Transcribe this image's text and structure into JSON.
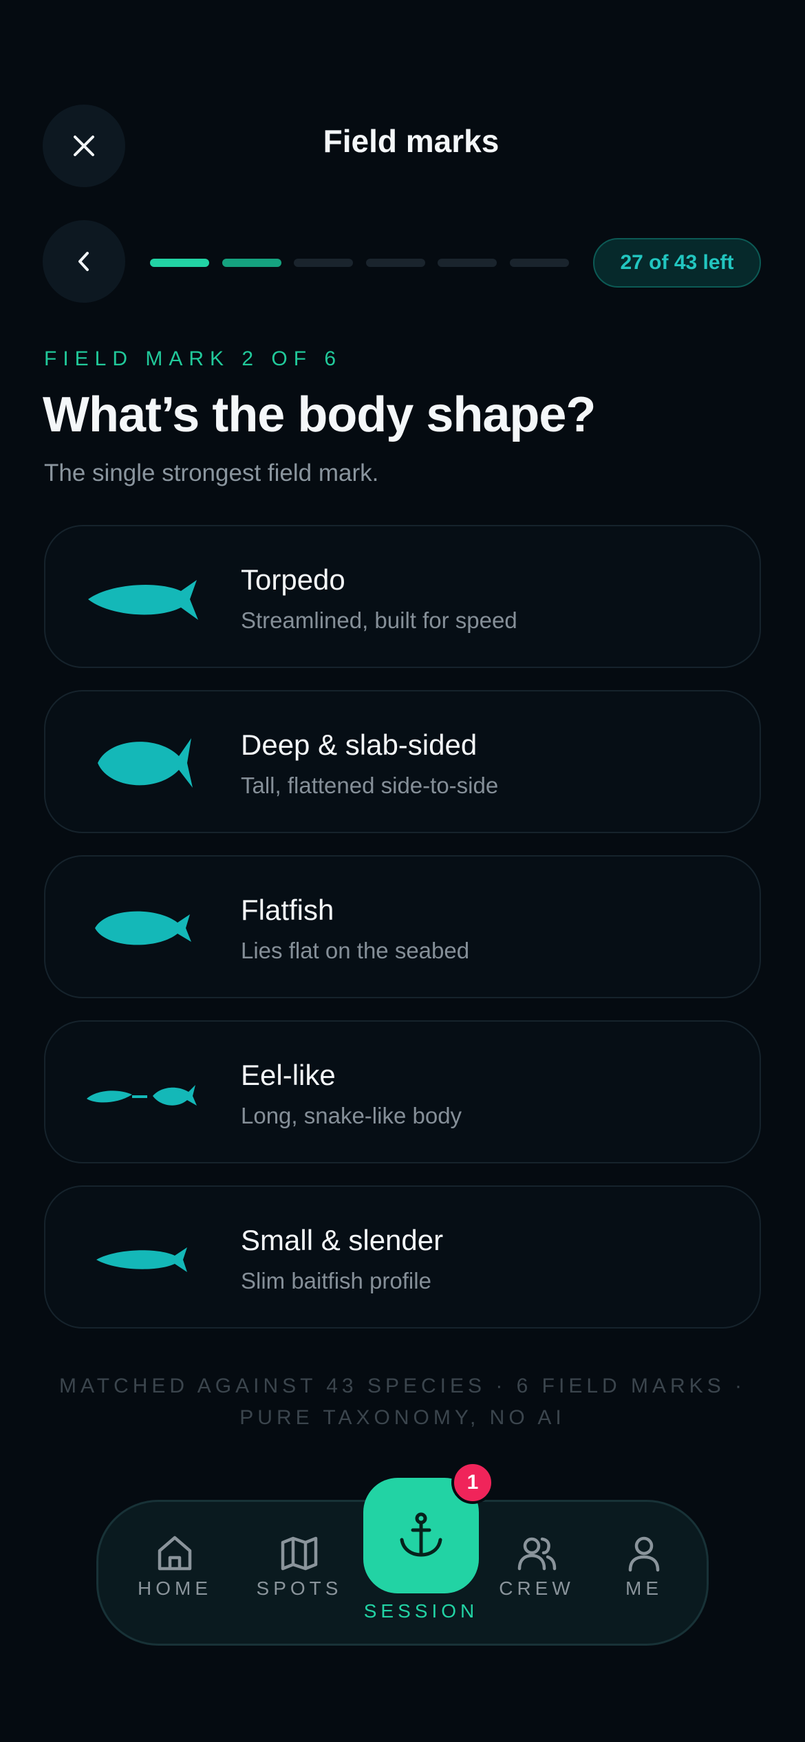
{
  "header": {
    "title": "Field marks",
    "close_icon": "close-icon",
    "back_icon": "chevron-left-icon"
  },
  "progress": {
    "total_steps": 6,
    "completed_steps": 2,
    "remaining_label": "27 of 43 left"
  },
  "question": {
    "eyebrow": "FIELD MARK 2 OF 6",
    "title": "What’s the body shape?",
    "subtitle": "The single strongest field mark."
  },
  "options": [
    {
      "label": "Torpedo",
      "description": "Streamlined, built for speed",
      "icon": "torpedo-fish-icon"
    },
    {
      "label": "Deep & slab-sided",
      "description": "Tall, flattened side-to-side",
      "icon": "deep-fish-icon"
    },
    {
      "label": "Flatfish",
      "description": "Lies flat on the seabed",
      "icon": "flatfish-icon"
    },
    {
      "label": "Eel-like",
      "description": "Long, snake-like body",
      "icon": "eel-icon"
    },
    {
      "label": "Small & slender",
      "description": "Slim baitfish profile",
      "icon": "slender-fish-icon"
    }
  ],
  "footnote": {
    "line1": "MATCHED AGAINST 43 SPECIES · 6 FIELD MARKS ·",
    "line2": "PURE TAXONOMY, NO AI"
  },
  "nav": {
    "items": [
      {
        "label": "HOME",
        "icon": "home-icon"
      },
      {
        "label": "SPOTS",
        "icon": "map-icon"
      },
      {
        "label": "SESSION",
        "icon": "anchor-icon"
      },
      {
        "label": "CREW",
        "icon": "users-icon"
      },
      {
        "label": "ME",
        "icon": "user-icon"
      }
    ],
    "session_badge": "1"
  },
  "colors": {
    "background": "#050b11",
    "accent": "#22d3a4",
    "fish": "#14b8b8",
    "badge": "#f0245a"
  }
}
